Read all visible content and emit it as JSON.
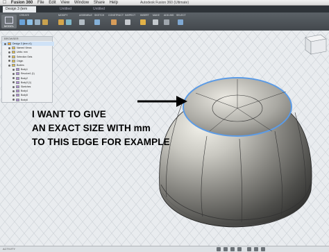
{
  "menubar": {
    "items": [
      "Fusion 360",
      "File",
      "Edit",
      "View",
      "Window",
      "Share",
      "Help"
    ],
    "window_title": "Autodesk Fusion 360 (Ultimate)"
  },
  "tabs": [
    {
      "label": "Design 3 (tem v1)"
    },
    {
      "label": "Untitled"
    },
    {
      "label": "Untitled"
    }
  ],
  "toolbar": {
    "workspace_label": "MODEL",
    "groups": [
      "CREATE",
      "MODIFY",
      "ASSEMBLE",
      "SKETCH",
      "CONSTRUCT",
      "INSPECT",
      "INSERT",
      "MAKE",
      "ADD-INS",
      "SELECT"
    ]
  },
  "browser": {
    "header": "BROWSER",
    "items": [
      {
        "label": "Design 3 (tem v1)",
        "level": 0
      },
      {
        "label": "Named Views",
        "level": 1
      },
      {
        "label": "Units: mm",
        "level": 1
      },
      {
        "label": "Selection Sets",
        "level": 1
      },
      {
        "label": "Origin",
        "level": 1
      },
      {
        "label": "Bodies",
        "level": 1
      },
      {
        "label": "Body1",
        "level": 2
      },
      {
        "label": "Revolve1 (1)",
        "level": 2
      },
      {
        "label": "Body2",
        "level": 2
      },
      {
        "label": "Body3 (1)",
        "level": 2
      },
      {
        "label": "Sketches",
        "level": 2
      },
      {
        "label": "Body4",
        "level": 2
      },
      {
        "label": "Body5",
        "level": 2
      },
      {
        "label": "Body6",
        "level": 2
      }
    ]
  },
  "annotation": {
    "lines": [
      "I WANT TO GIVE",
      "AN EXACT SIZE WITH mm",
      "TO THIS EDGE FOR EXAMPLE"
    ]
  },
  "statusbar": {
    "activity": "ACTIVITY"
  },
  "colors": {
    "toolbar_dark": "#4a4f54",
    "edge_highlight": "#5b9be6",
    "body_metal": "#8a8a86"
  }
}
